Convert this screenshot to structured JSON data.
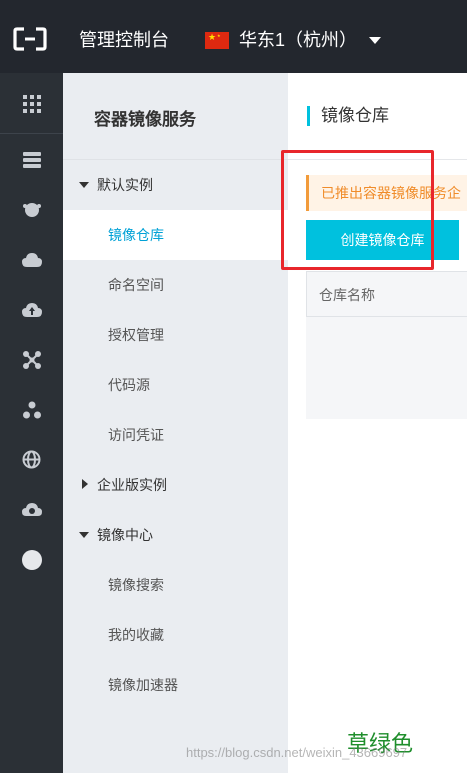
{
  "topbar": {
    "console_label": "管理控制台",
    "region_label": "华东1（杭州）",
    "logo_icon": "aliyun-logo-icon",
    "flag_icon": "china-flag-icon"
  },
  "rail": {
    "icons": [
      "grid-icon",
      "server-icon",
      "cow-icon",
      "cloud-download-icon",
      "cloud-upload-icon",
      "network-icon",
      "cluster-icon",
      "globe-icon",
      "cloud-gear-icon",
      "circle-icon"
    ]
  },
  "nav": {
    "title": "容器镜像服务",
    "default_instance": "默认实例",
    "repos": "镜像仓库",
    "namespaces": "命名空间",
    "auth": "授权管理",
    "code_source": "代码源",
    "access_credential": "访问凭证",
    "enterprise_instance": "企业版实例",
    "image_center": "镜像中心",
    "image_search": "镜像搜索",
    "favorites": "我的收藏",
    "accelerator": "镜像加速器"
  },
  "main": {
    "page_title": "镜像仓库",
    "notice": "已推出容器镜像服务企",
    "create_button": "创建镜像仓库",
    "col_repo_name": "仓库名称"
  },
  "annotation": {
    "handwritten": "草绿色",
    "watermark": "https://blog.csdn.net/weixin_43669697"
  },
  "colors": {
    "accent": "#00c1de",
    "topbar": "#23272e",
    "rail": "#2b3036",
    "nav": "#eaedf1",
    "highlight": "#e8262b"
  }
}
